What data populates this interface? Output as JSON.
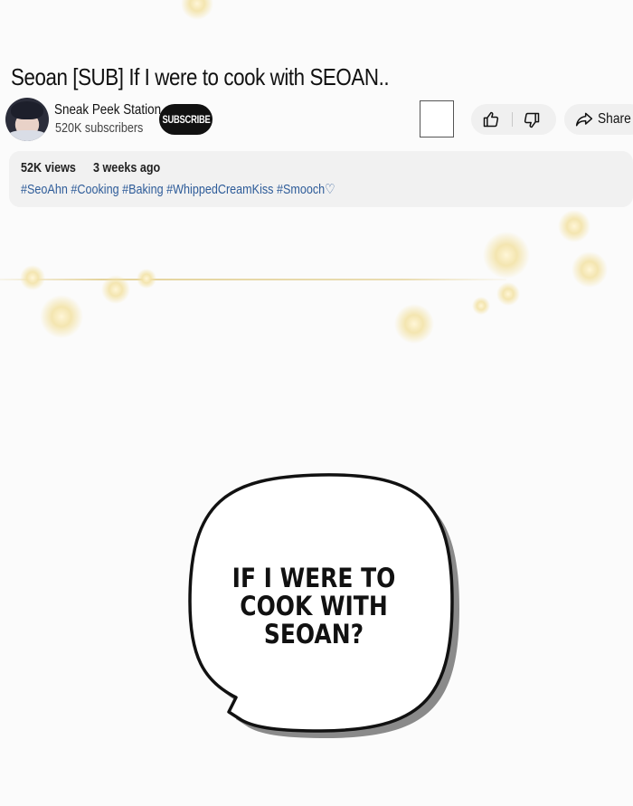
{
  "video": {
    "title": "Seoan [SUB] If I were to cook with SEOAN.."
  },
  "channel": {
    "name": "Sneak Peek Station",
    "subscribers": "520K subscribers",
    "subscribe_label": "SUBSCRIBE"
  },
  "actions": {
    "share_label": "Share"
  },
  "description": {
    "views": "52K views",
    "posted": "3 weeks ago",
    "hashtags": "#SeoAhn #Cooking #Baking #WhippedCreamKiss #Smooch♡"
  },
  "speech_bubble": {
    "lines": [
      "IF I WERE TO",
      "COOK WITH",
      "SEOAN?"
    ]
  },
  "colors": {
    "hashtag": "#2e5c99",
    "sparkle": "#f3e3a8",
    "subscribe_bg": "#111111"
  },
  "icons": [
    "like-icon",
    "dislike-icon",
    "share-icon",
    "avatar"
  ]
}
